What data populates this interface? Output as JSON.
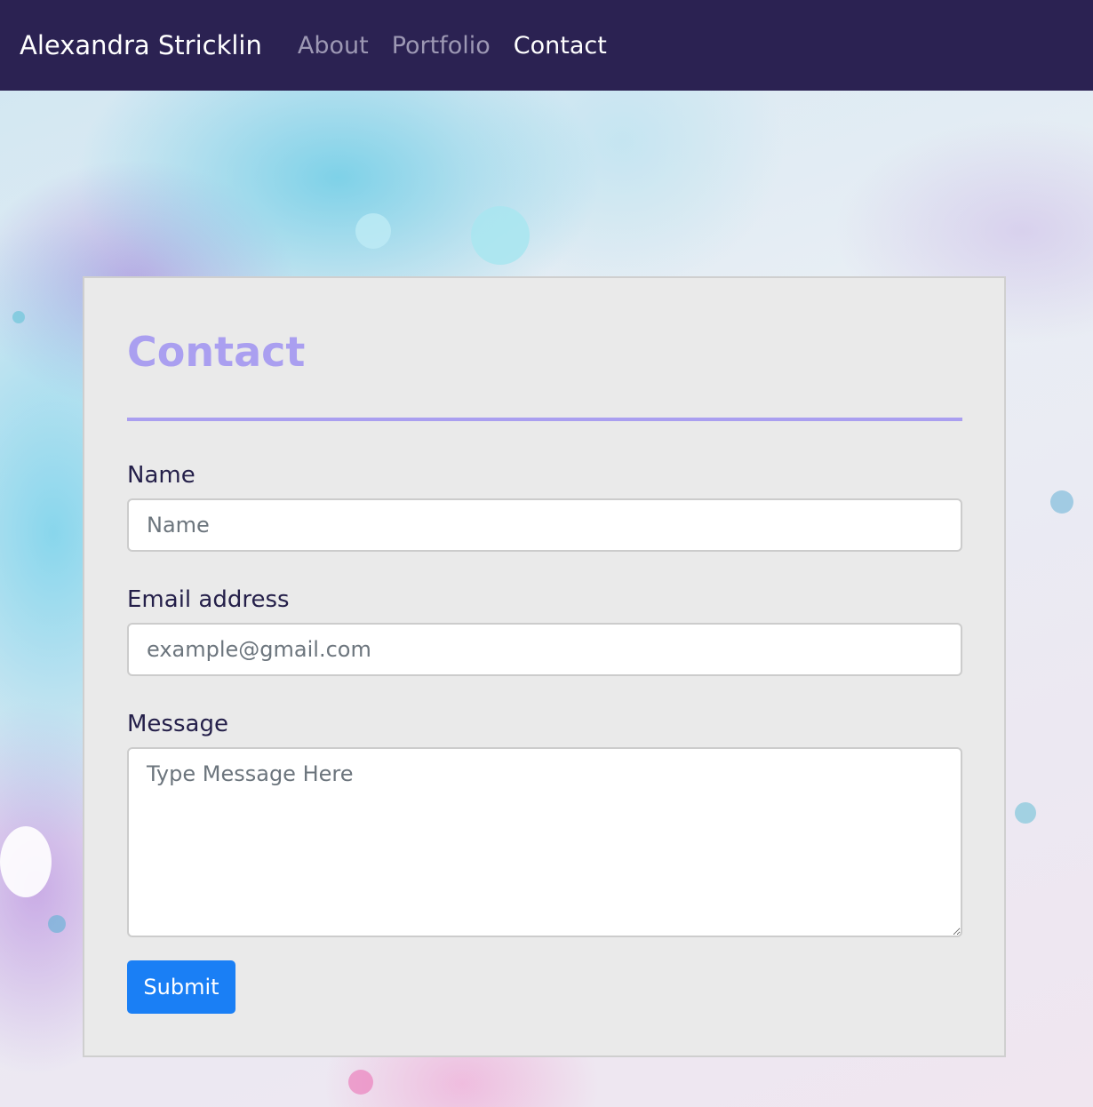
{
  "navbar": {
    "brand": "Alexandra Stricklin",
    "links": [
      {
        "label": "About",
        "active": false
      },
      {
        "label": "Portfolio",
        "active": false
      },
      {
        "label": "Contact",
        "active": true
      }
    ]
  },
  "contact": {
    "title": "Contact",
    "fields": {
      "name": {
        "label": "Name",
        "placeholder": "Name",
        "value": ""
      },
      "email": {
        "label": "Email address",
        "placeholder": "example@gmail.com",
        "value": ""
      },
      "message": {
        "label": "Message",
        "placeholder": "Type Message Here",
        "value": ""
      }
    },
    "submit_label": "Submit"
  },
  "colors": {
    "navbar_bg": "#2b2252",
    "accent": "#aa9ff0",
    "button": "#1a7ff5",
    "card_bg": "#eaeaea",
    "label_text": "#25204a"
  }
}
